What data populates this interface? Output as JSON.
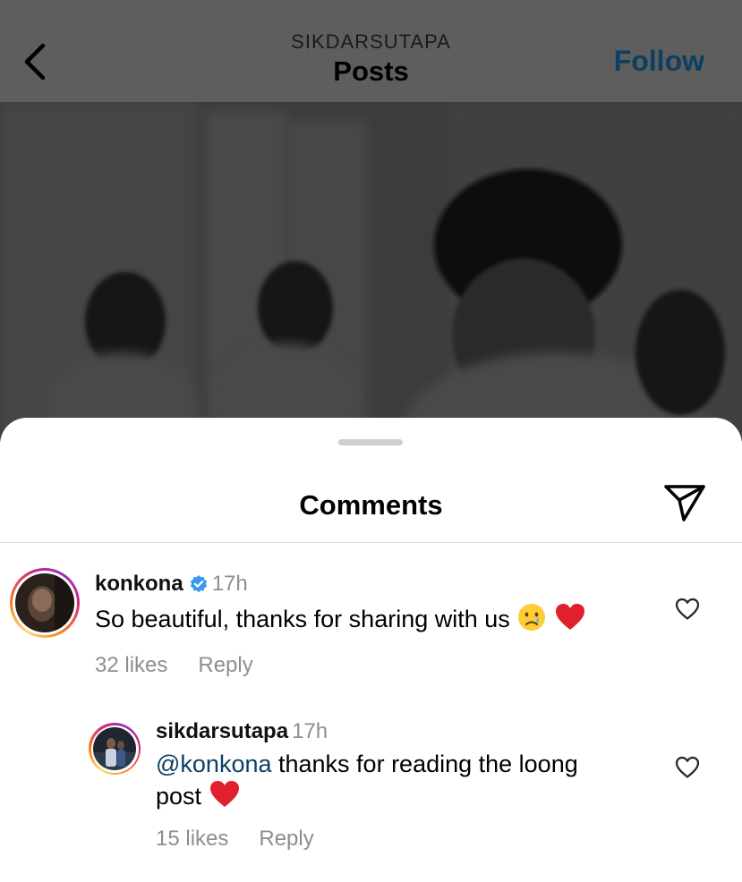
{
  "header": {
    "account": "SIKDARSUTAPA",
    "title": "Posts",
    "follow_label": "Follow",
    "back_icon": "chevron-left-icon"
  },
  "sheet": {
    "title": "Comments",
    "share_icon": "paper-plane-icon"
  },
  "comments": [
    {
      "username": "konkona",
      "verified": true,
      "time": "17h",
      "text": "So beautiful, thanks for sharing with us",
      "emojis": [
        "crying-face-emoji",
        "red-heart-emoji"
      ],
      "likes": "32 likes",
      "reply_label": "Reply"
    },
    {
      "username": "sikdarsutapa",
      "verified": false,
      "time": "17h",
      "mention": "@konkona",
      "text_line1": " thanks for reading the loong",
      "text_line2": "post",
      "emojis": [
        "red-heart-emoji"
      ],
      "likes": "15 likes",
      "reply_label": "Reply"
    }
  ],
  "colors": {
    "follow": "#0b3f63",
    "mention": "#0b3f63",
    "muted": "#8e8e8e",
    "verified": "#3897f0",
    "heart": "#e0202a"
  }
}
